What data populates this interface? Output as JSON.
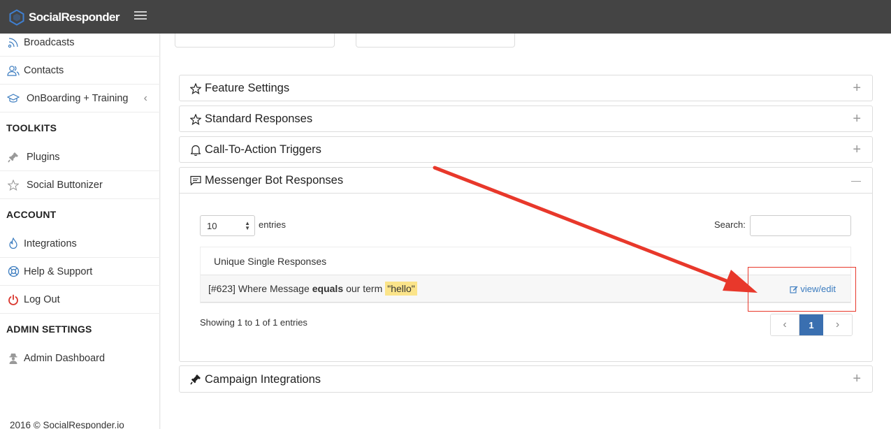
{
  "app": {
    "brand": "SocialResponder"
  },
  "sidebar": {
    "items": [
      {
        "label": "Broadcasts",
        "icon": "rss-icon"
      },
      {
        "label": "Contacts",
        "icon": "users-icon"
      },
      {
        "label": "OnBoarding + Training",
        "icon": "graduation-cap-icon",
        "chevron": "‹"
      }
    ],
    "toolkits_heading": "TOOLKITS",
    "toolkit_items": [
      {
        "label": "Plugins",
        "icon": "plug-icon"
      },
      {
        "label": "Social Buttonizer",
        "icon": "star-icon"
      }
    ],
    "account_heading": "ACCOUNT",
    "account_items": [
      {
        "label": "Integrations",
        "icon": "fire-icon"
      },
      {
        "label": "Help & Support",
        "icon": "life-ring-icon"
      },
      {
        "label": "Log Out",
        "icon": "power-icon"
      }
    ],
    "admin_heading": "ADMIN SETTINGS",
    "admin_items": [
      {
        "label": "Admin Dashboard",
        "icon": "user-secret-icon"
      }
    ],
    "footer": "2016 © SocialResponder.io"
  },
  "panels": [
    {
      "title": "Feature Settings",
      "icon": "star-icon",
      "toggle": "+"
    },
    {
      "title": "Standard Responses",
      "icon": "star-icon",
      "toggle": "+"
    },
    {
      "title": "Call-To-Action Triggers",
      "icon": "bell-icon",
      "toggle": "+"
    },
    {
      "title": "Messenger Bot Responses",
      "icon": "comment-icon",
      "toggle": "—"
    },
    {
      "title": "Campaign Integrations",
      "icon": "plug-icon",
      "toggle": "+"
    }
  ],
  "messenger": {
    "entries_value": "10",
    "entries_label": "entries",
    "search_label": "Search:",
    "search_value": "",
    "table_header": "Unique Single Responses",
    "row": {
      "prefix": "[#623] Where Message",
      "operator": "equals",
      "middle": "our term",
      "term": "\"hello\"",
      "action": "view/edit"
    },
    "showing": "Showing 1 to 1 of 1 entries",
    "pagination": {
      "prev": "‹",
      "page": "1",
      "next": "›"
    }
  },
  "colors": {
    "topbar": "#444444",
    "link": "#3a7bbf",
    "highlight": "#fbe48a",
    "annotation": "#e8382b",
    "pager_active": "#3a6fb0"
  }
}
